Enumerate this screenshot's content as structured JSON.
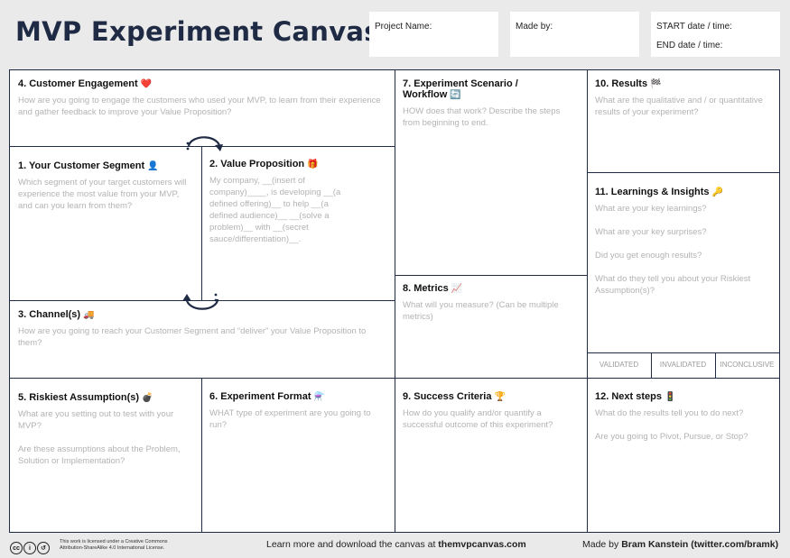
{
  "title": "MVP Experiment Canvas",
  "header_fields": {
    "project_name": "Project Name:",
    "made_by": "Made by:",
    "start": "START date / time:",
    "end": "END date / time:"
  },
  "sections": {
    "s4": {
      "title": "4. Customer Engagement",
      "emoji": "❤️",
      "lines": [
        "How are you going to engage the customers who used your MVP, to learn from their experience and gather feedback to improve your Value Proposition?"
      ]
    },
    "s7": {
      "title": "7. Experiment Scenario / Workflow",
      "emoji": "🔄",
      "lines": [
        "HOW does that work? Describe the steps from beginning to end."
      ]
    },
    "s10": {
      "title": "10. Results",
      "emoji": "🏁",
      "lines": [
        "What are the qualitative and / or quantitative results of your experiment?"
      ]
    },
    "s1": {
      "title": "1. Your Customer Segment",
      "emoji": "👤",
      "lines": [
        "Which segment of your target customers will experience the most value from your MVP, and can you learn from them?"
      ]
    },
    "s2": {
      "title": "2. Value Proposition",
      "emoji": "🎁",
      "lines": [
        "My company, __(insert of company)____, is developing __(a defined offering)__ to help __(a defined audience)__ __(solve a problem)__ with __(secret sauce/differentiation)__."
      ]
    },
    "s11": {
      "title": "11. Learnings & Insights",
      "emoji": "🔑",
      "q1": "What are your key learnings?",
      "q2": "What are your key surprises?",
      "q3": "Did you get enough results?",
      "q4": "What do they tell you about your Riskiest Assumption(s)?"
    },
    "s8": {
      "title": "8. Metrics",
      "emoji": "📈",
      "lines": [
        "What will you measure? (Can be multiple metrics)"
      ]
    },
    "s3": {
      "title": "3. Channel(s)",
      "emoji": "🚚",
      "lines": [
        "How are you going to reach your Customer Segment and “deliver” your Value Proposition to them?"
      ]
    },
    "s5": {
      "title": "5. Riskiest Assumption(s)",
      "emoji": "💣",
      "q1": "What are you setting out to test with your MVP?",
      "q2": "Are these assumptions about the Problem, Solution or Implementation?"
    },
    "s6": {
      "title": "6. Experiment Format",
      "emoji": "⚗️",
      "lines": [
        "WHAT type of experiment are you going to run?"
      ]
    },
    "s9": {
      "title": "9. Success Criteria",
      "emoji": "🏆",
      "lines": [
        "How do you qualify and/or quantify a successful outcome of this experiment?"
      ]
    },
    "s12": {
      "title": "12. Next steps",
      "emoji": "🚦",
      "q1": "What do the results tell you to do next?",
      "q2": "Are you going to Pivot, Pursue, or Stop?"
    }
  },
  "status": {
    "validated": "VALIDATED",
    "invalidated": "INVALIDATED",
    "inconclusive": "INCONCLUSIVE"
  },
  "footer": {
    "license": "This work is licensed under a Creative Commons Attribution-ShareAlike 4.0 International License.",
    "learn_prefix": "Learn more and download the canvas at ",
    "learn_link": "themvpcanvas.com",
    "made_by_prefix": "Made by ",
    "made_by_name": "Bram Kanstein (twitter.com/bramk)",
    "cc_icons": [
      "cc-icon",
      "by-icon",
      "sa-icon"
    ]
  }
}
